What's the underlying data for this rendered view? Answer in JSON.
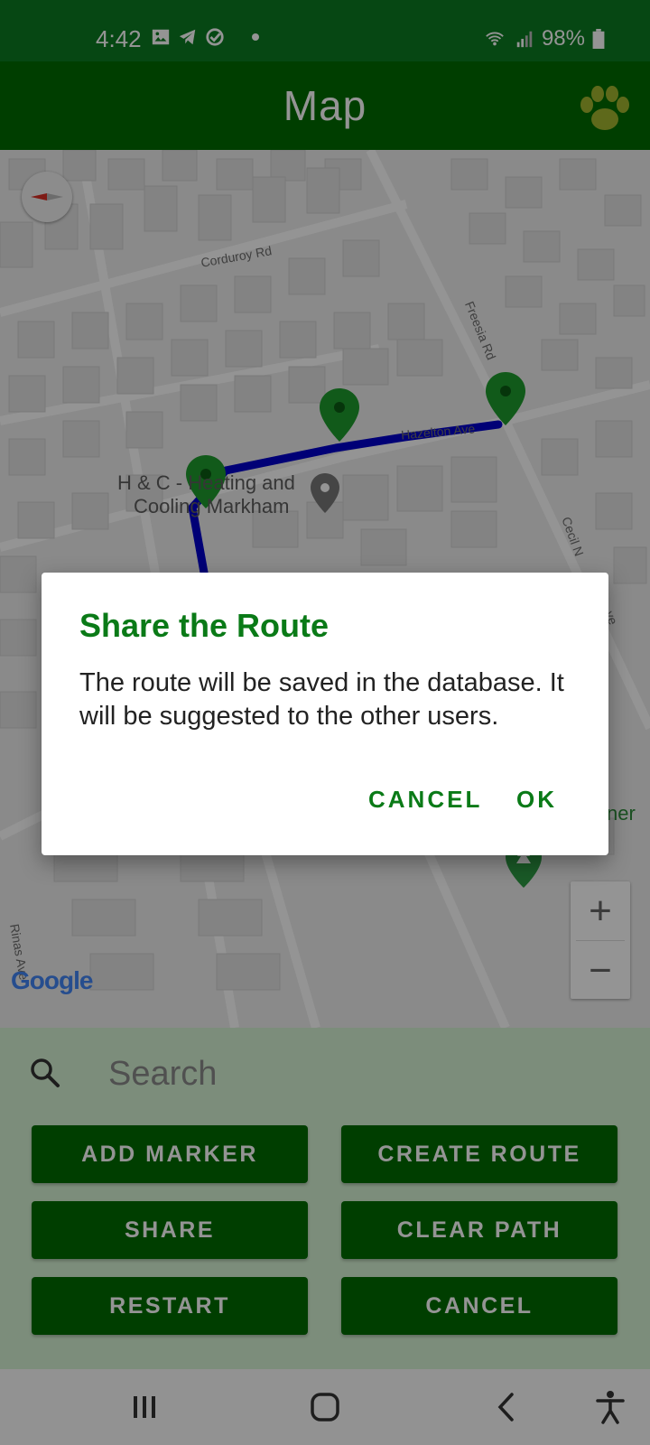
{
  "status_bar": {
    "time": "4:42",
    "battery": "98%"
  },
  "app_bar": {
    "title": "Map"
  },
  "map": {
    "streets": [
      "Corduroy Rd",
      "Freesia Rd",
      "Hazelton Ave",
      "Cecil N",
      "ve",
      "Rinas Ave"
    ],
    "place": {
      "line1": "H & C - Heating and",
      "line2": "Cooling Markham"
    },
    "partial_label": "ner",
    "zoom_in": "+",
    "zoom_out": "−",
    "logo": "Google"
  },
  "search": {
    "placeholder": "Search"
  },
  "buttons": {
    "add_marker": "ADD MARKER",
    "create_route": "CREATE ROUTE",
    "share": "SHARE",
    "clear_path": "CLEAR PATH",
    "restart": "RESTART",
    "cancel": "CANCEL"
  },
  "dialog": {
    "title": "Share the Route",
    "message": "The route will be saved in the database. It will be suggested to the other users.",
    "cancel": "CANCEL",
    "ok": "OK"
  },
  "colors": {
    "status_bar": "#0c7a22",
    "app_bar": "#016b01",
    "accent": "#0a7a17",
    "route": "#0000cc",
    "marker": "#1e9b2d",
    "panel": "#d6f3d4"
  }
}
